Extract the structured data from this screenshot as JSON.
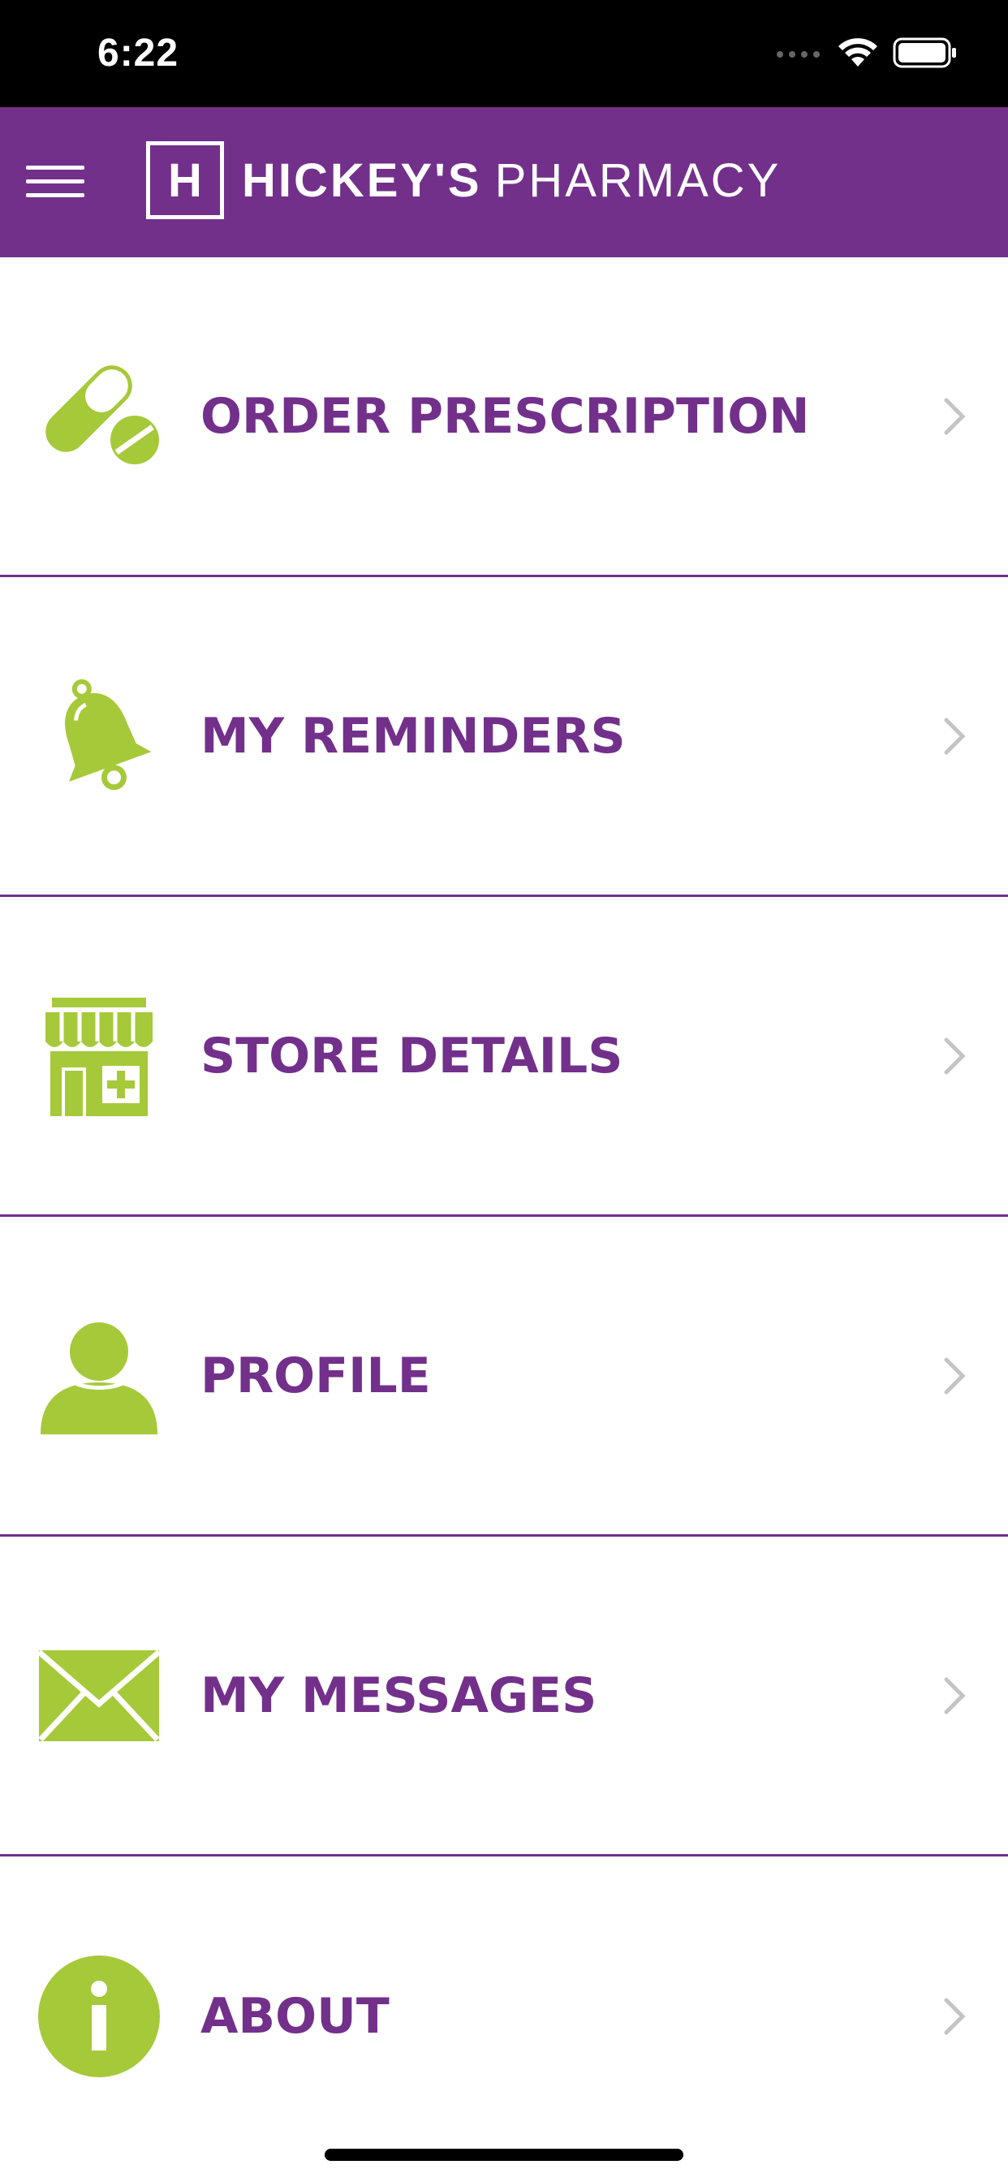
{
  "status_bar": {
    "time": "6:22"
  },
  "header": {
    "logo_letter": "H",
    "logo_brand": "HICKEY'S",
    "logo_suffix": "PHARMACY",
    "background_color": "#72308b"
  },
  "menu": {
    "items": [
      {
        "label": "ORDER PRESCRIPTION",
        "icon": "pills-icon"
      },
      {
        "label": "MY REMINDERS",
        "icon": "bell-icon"
      },
      {
        "label": "STORE DETAILS",
        "icon": "store-icon"
      },
      {
        "label": "PROFILE",
        "icon": "person-icon"
      },
      {
        "label": "MY MESSAGES",
        "icon": "envelope-icon"
      },
      {
        "label": "ABOUT",
        "icon": "info-icon"
      }
    ],
    "label_color": "#72308b",
    "icon_color": "#a6c93a",
    "chevron_color": "#c4c4c7"
  }
}
